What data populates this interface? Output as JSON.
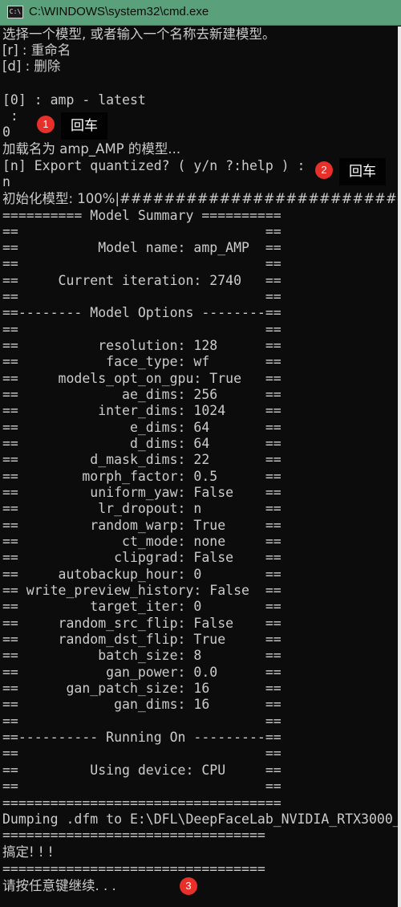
{
  "window": {
    "icon_text": "C:\\",
    "title": "C:\\WINDOWS\\system32\\cmd.exe"
  },
  "console": {
    "lines": [
      "选择一个模型, 或者输入一个名称去新建模型。",
      "[r] : 重命名",
      "[d] : 删除",
      "",
      "[0] : amp - latest",
      " :",
      "0",
      "加载名为 amp_AMP 的模型...",
      "[n] Export quantized? ( y/n ?:help ) :",
      "n",
      "初始化模型: 100%|################################################",
      "========== Model Summary ==========",
      "==                               ==",
      "==          Model name: amp_AMP  ==",
      "==                               ==",
      "==     Current iteration: 2740   ==",
      "==                               ==",
      "==-------- Model Options --------==",
      "==                               ==",
      "==          resolution: 128      ==",
      "==           face_type: wf       ==",
      "==     models_opt_on_gpu: True   ==",
      "==             ae_dims: 256      ==",
      "==          inter_dims: 1024     ==",
      "==              e_dims: 64       ==",
      "==              d_dims: 64       ==",
      "==         d_mask_dims: 22       ==",
      "==        morph_factor: 0.5      ==",
      "==         uniform_yaw: False    ==",
      "==          lr_dropout: n        ==",
      "==         random_warp: True     ==",
      "==             ct_mode: none     ==",
      "==            clipgrad: False    ==",
      "==     autobackup_hour: 0        ==",
      "== write_preview_history: False  ==",
      "==         target_iter: 0        ==",
      "==     random_src_flip: False    ==",
      "==     random_dst_flip: True     ==",
      "==          batch_size: 8        ==",
      "==           gan_power: 0.0      ==",
      "==      gan_patch_size: 16       ==",
      "==            gan_dims: 16       ==",
      "==                               ==",
      "==---------- Running On ---------==",
      "==                               ==",
      "==         Using device: CPU     ==",
      "==                               ==",
      "===================================",
      "Dumping .dfm to E:\\DFL\\DeepFaceLab_NVIDIA_RTX3000_",
      "=================================",
      "搞定! ! !",
      "=================================",
      "请按任意键继续. . ."
    ]
  },
  "annotations": [
    {
      "number": "1",
      "label": "回车"
    },
    {
      "number": "2",
      "label": "回车"
    },
    {
      "number": "3",
      "label": ""
    }
  ],
  "colors": {
    "titlebar": "#5aa07a",
    "console_bg": "#0c0c0c",
    "console_text": "#cccccc",
    "badge": "#e8302a"
  }
}
